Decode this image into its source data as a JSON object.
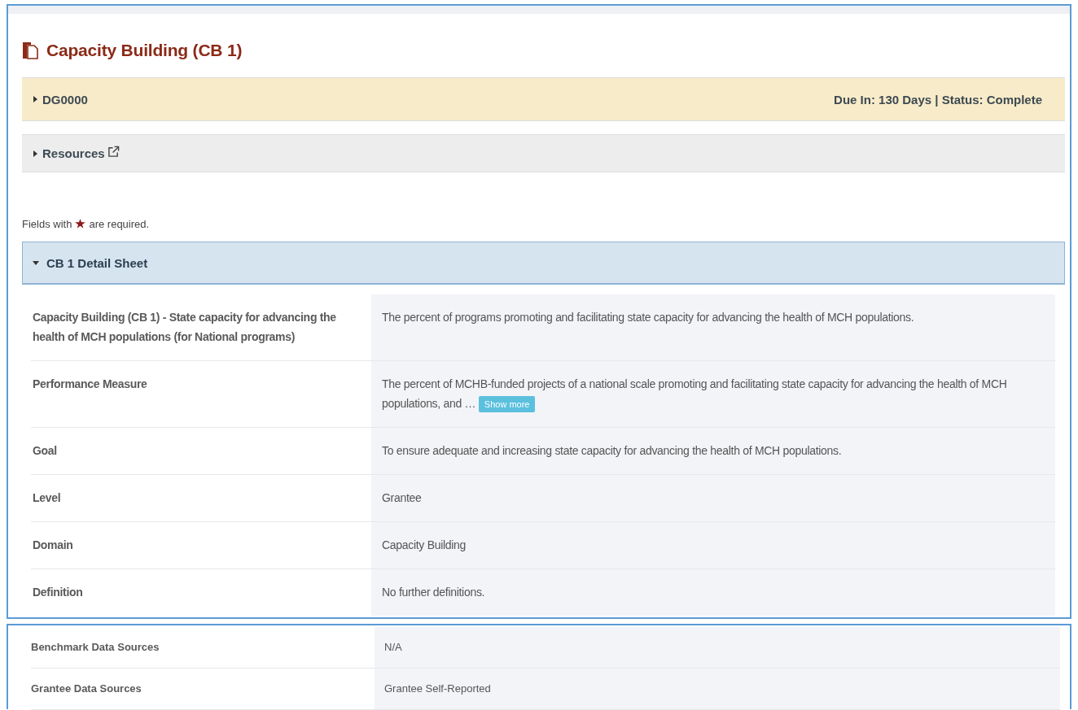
{
  "page_title": "Capacity Building (CB 1)",
  "due_bar": {
    "label": "DG0000",
    "expanded": false,
    "status": "Due In: 130 Days | Status: Complete"
  },
  "resources_bar": {
    "label": "Resources",
    "expanded": false
  },
  "required_note": {
    "before": "Fields with",
    "after": "are required."
  },
  "detail_sheet": {
    "title": "CB 1 Detail Sheet",
    "expanded": true,
    "rows": [
      {
        "label": "Capacity Building (CB 1) - State capacity for advancing the health of MCH populations (for National programs)",
        "value": "The percent of programs promoting and facilitating state capacity for advancing the health of MCH populations."
      },
      {
        "label": "Performance Measure",
        "value": "The percent of MCHB-funded projects of a national scale promoting and facilitating state capacity for advancing the health of MCH populations, and …",
        "action": "Show more"
      },
      {
        "label": "Goal",
        "value": "To ensure adequate and increasing state capacity for advancing the health of MCH populations."
      },
      {
        "label": "Level",
        "value": "Grantee"
      },
      {
        "label": "Domain",
        "value": "Capacity Building"
      },
      {
        "label": "Definition",
        "value": "No further definitions."
      }
    ]
  },
  "detail_sheet_continued": {
    "rows": [
      {
        "label": "Benchmark Data Sources",
        "value": "N/A"
      },
      {
        "label": "Grantee Data Sources",
        "value": "Grantee Self-Reported"
      }
    ]
  }
}
